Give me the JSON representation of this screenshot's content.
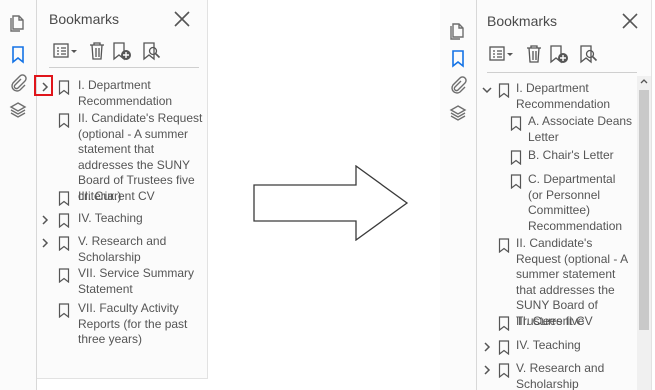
{
  "left_panel": {
    "title": "Bookmarks",
    "items": [
      {
        "label": "I. Department Recommendation",
        "expandable": true,
        "highlighted": true
      },
      {
        "label": "II. Candidate's Request (optional - A summer statement that addresses the SUNY Board of Trustees five criteria.)",
        "expandable": false
      },
      {
        "label": "III. Current CV",
        "expandable": false
      },
      {
        "label": "IV. Teaching",
        "expandable": true
      },
      {
        "label": "V. Research and Scholarship",
        "expandable": true
      },
      {
        "label": "VII. Service Summary Statement",
        "expandable": false
      },
      {
        "label": "VII. Faculty Activity Reports (for the past three years)",
        "expandable": false
      }
    ]
  },
  "right_panel": {
    "title": "Bookmarks",
    "items": [
      {
        "label": "I. Department Recommendation",
        "expanded": true,
        "level": 0
      },
      {
        "label": "A. Associate Deans Letter",
        "level": 1
      },
      {
        "label": "B. Chair's Letter",
        "level": 1
      },
      {
        "label": "C. Departmental (or Personnel Committee) Recommendation",
        "level": 1
      },
      {
        "label": "II. Candidate's Request (optional - A summer statement that addresses the SUNY Board of Trustees five",
        "level": 0
      },
      {
        "label": "III. Current CV",
        "level": 0
      },
      {
        "label": "IV. Teaching",
        "expandable": true,
        "level": 0
      },
      {
        "label": "V. Research and Scholarship",
        "expandable": true,
        "level": 0
      }
    ]
  },
  "icons": {
    "side_strip": [
      "pages-icon",
      "bookmark-icon",
      "paperclip-icon",
      "layers-icon"
    ],
    "toolbar": [
      "options-menu-icon",
      "delete-icon",
      "new-bookmark-icon",
      "bookmark-search-icon"
    ]
  },
  "colors": {
    "accent_blue": "#1473e6",
    "highlight_red": "#e0151b",
    "icon_gray": "#6e6e6e"
  }
}
